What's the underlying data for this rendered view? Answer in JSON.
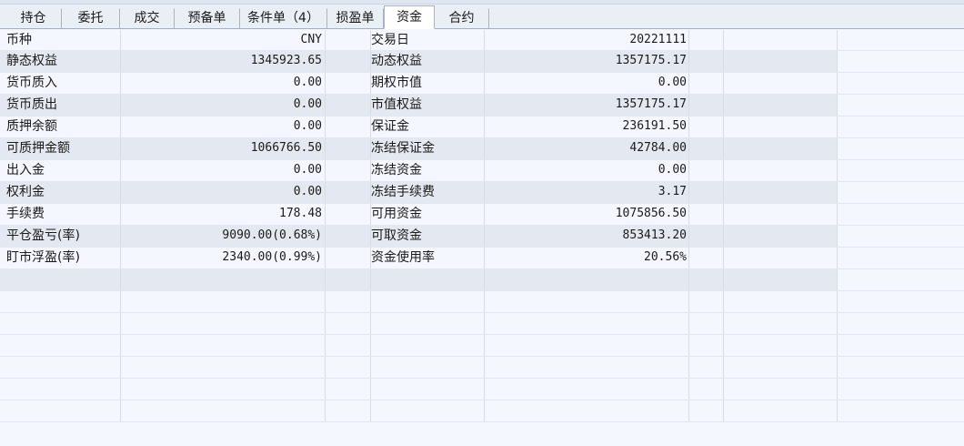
{
  "tabs": [
    {
      "label": "持仓",
      "width": 62
    },
    {
      "label": "委托",
      "width": 64
    },
    {
      "label": "成交",
      "width": 60
    },
    {
      "label": "预备单",
      "width": 72
    },
    {
      "label": "条件单（4）",
      "width": 96
    },
    {
      "label": "损盈单",
      "width": 62
    },
    {
      "label": "资金",
      "width": 56,
      "active": true
    },
    {
      "label": "合约",
      "width": 60
    }
  ],
  "rows": [
    {
      "l1": "币种",
      "v1": "CNY",
      "l2": "交易日",
      "v2": "20221111"
    },
    {
      "l1": "静态权益",
      "v1": "1345923.65",
      "l2": "动态权益",
      "v2": "1357175.17"
    },
    {
      "l1": "货币质入",
      "v1": "0.00",
      "l2": "期权市值",
      "v2": "0.00"
    },
    {
      "l1": "货币质出",
      "v1": "0.00",
      "l2": "市值权益",
      "v2": "1357175.17"
    },
    {
      "l1": "质押余额",
      "v1": "0.00",
      "l2": "保证金",
      "v2": "236191.50"
    },
    {
      "l1": "可质押金额",
      "v1": "1066766.50",
      "l2": "冻结保证金",
      "v2": "42784.00"
    },
    {
      "l1": "出入金",
      "v1": "0.00",
      "l2": "冻结资金",
      "v2": "0.00"
    },
    {
      "l1": "权利金",
      "v1": "0.00",
      "l2": "冻结手续费",
      "v2": "3.17"
    },
    {
      "l1": "手续费",
      "v1": "178.48",
      "l2": "可用资金",
      "v2": "1075856.50"
    },
    {
      "l1": "平仓盈亏(率)",
      "v1": "9090.00(0.68%)",
      "l2": "可取资金",
      "v2": "853413.20"
    },
    {
      "l1": "盯市浮盈(率)",
      "v1": "2340.00(0.99%)",
      "l2": "资金使用率",
      "v2": "20.56%"
    }
  ]
}
